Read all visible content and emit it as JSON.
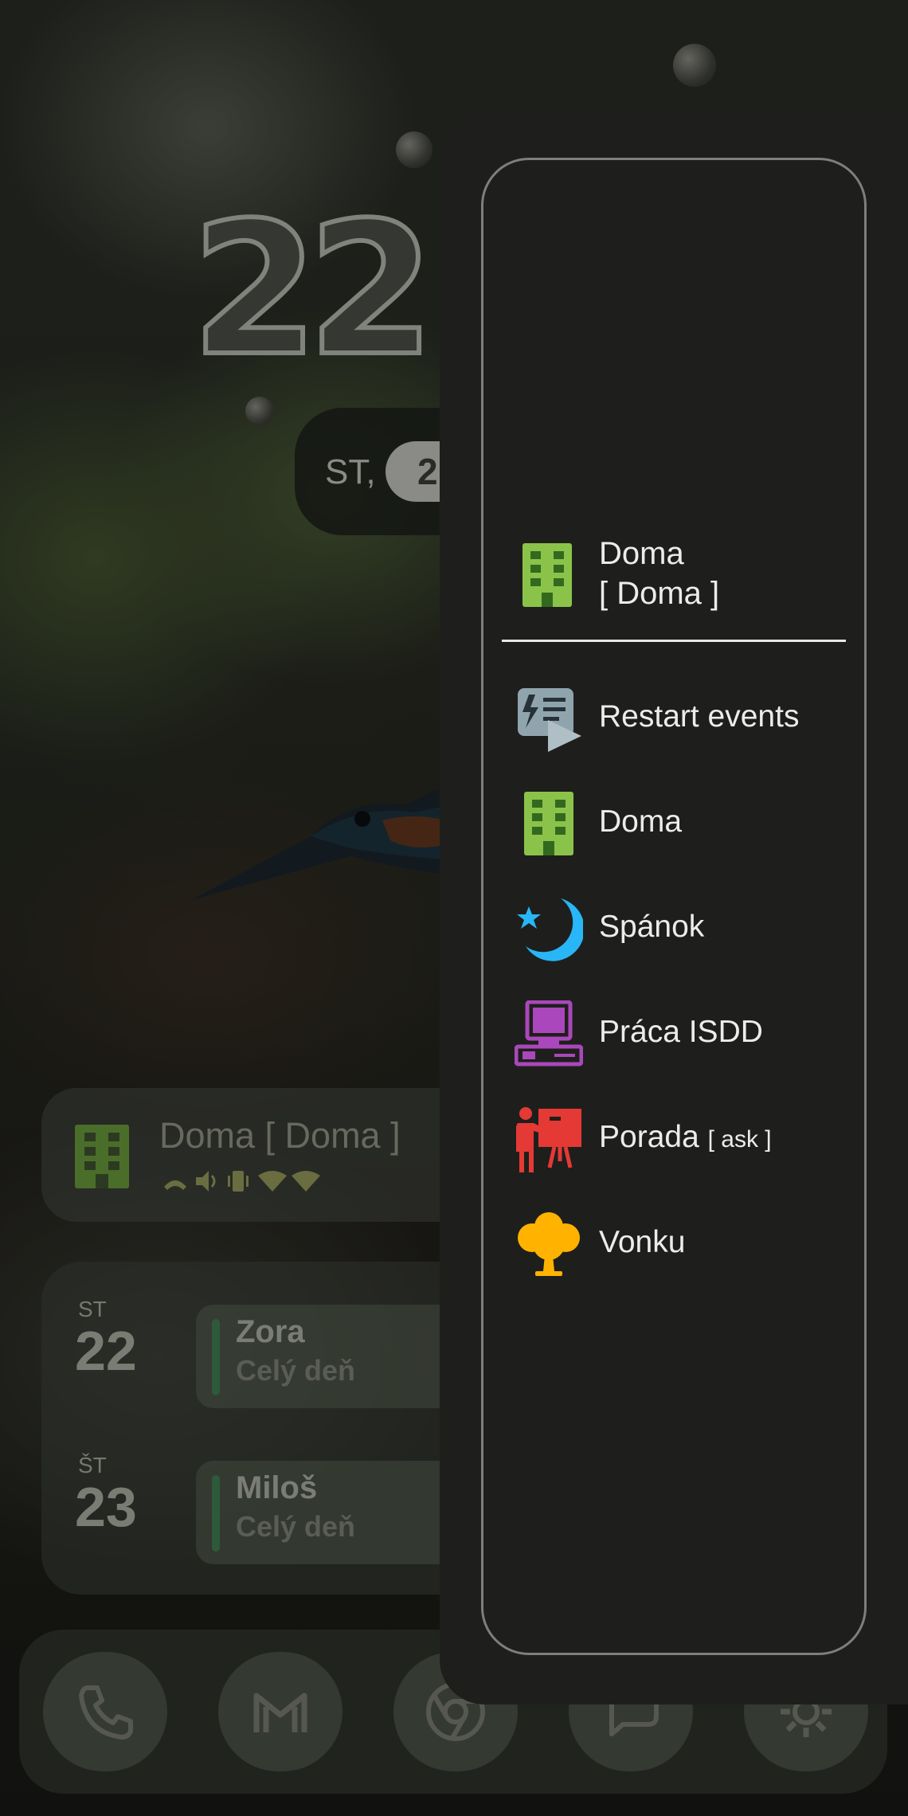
{
  "clock": {
    "time": "22:"
  },
  "date": {
    "day": "ST,",
    "number": "2"
  },
  "mode_widget": {
    "title": "Doma [ Doma ]"
  },
  "calendar": {
    "rows": [
      {
        "dow": "ST",
        "day": "22",
        "event": "Zora",
        "time": "Celý deň"
      },
      {
        "dow": "ŠT",
        "day": "23",
        "event": "Miloš",
        "time": "Celý deň"
      }
    ]
  },
  "panel": {
    "current": {
      "line1": "Doma",
      "line2": "[ Doma ]"
    },
    "items": [
      {
        "label": "Restart events",
        "suffix": "",
        "icon": "restart-events-icon"
      },
      {
        "label": "Doma",
        "suffix": "",
        "icon": "building-icon"
      },
      {
        "label": "Spánok",
        "suffix": "",
        "icon": "moon-star-icon"
      },
      {
        "label": "Práca ISDD",
        "suffix": "",
        "icon": "computer-icon"
      },
      {
        "label": "Porada",
        "suffix": "[ ask ]",
        "icon": "presentation-icon"
      },
      {
        "label": "Vonku",
        "suffix": "",
        "icon": "tree-icon"
      }
    ]
  },
  "colors": {
    "building": "#8bc34a",
    "moon": "#29b6f6",
    "computer": "#ab47bc",
    "presentation": "#e53935",
    "tree": "#ffb300",
    "restart": "#90a4ae"
  }
}
